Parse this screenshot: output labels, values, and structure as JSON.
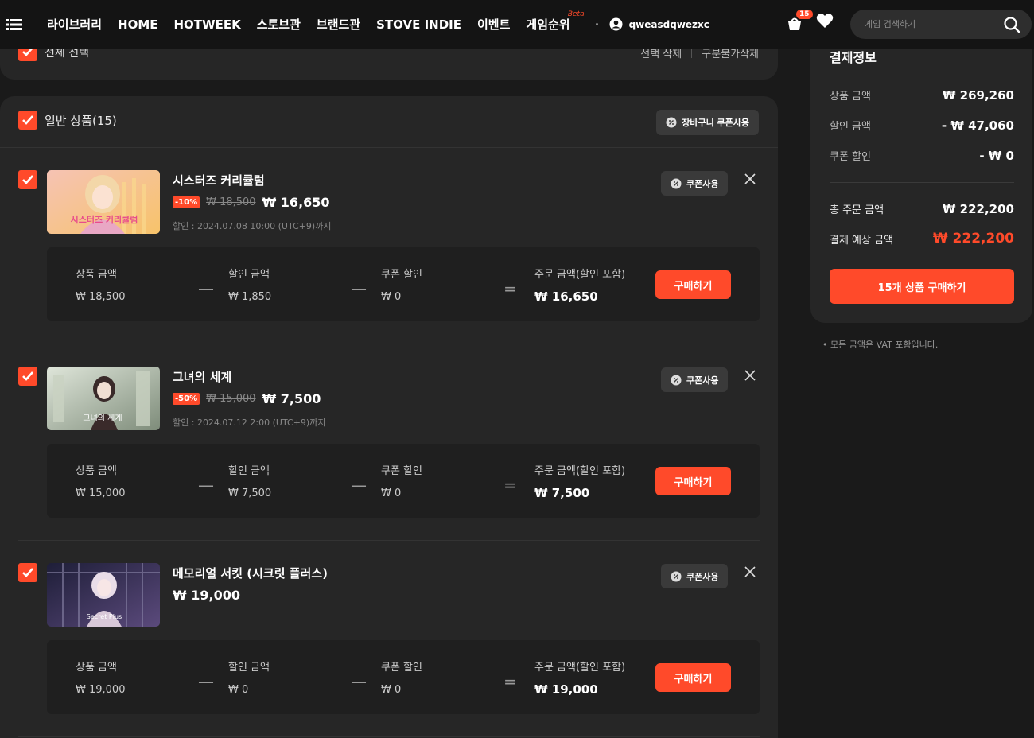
{
  "nav": {
    "links": [
      "라이브러리",
      "HOME",
      "HOTWEEK",
      "스토브관",
      "브랜드관",
      "STOVE INDIE",
      "이벤트",
      "게임순위"
    ],
    "beta": "Beta",
    "username": "qweasdqwezxc",
    "cart_count": "15",
    "search_placeholder": "게임 검색하기"
  },
  "top": {
    "select_all": "전체 선택",
    "delete_selected": "선택 삭제",
    "delete_unavailable": "구분불가삭제"
  },
  "section": {
    "title": "일반 상품(15)",
    "cart_coupon": "장바구니 쿠폰사용"
  },
  "labels": {
    "coupon_use": "쿠폰사용",
    "product_amount": "상품 금액",
    "discount_amount": "할인 금액",
    "coupon_discount": "쿠폰 할인",
    "order_amount": "주문 금액(할인 포함)",
    "buy": "구매하기"
  },
  "items": [
    {
      "name": "시스터즈 커리큘럼",
      "discount": "-10%",
      "original": "₩ 18,500",
      "final": "₩ 16,650",
      "until": "할인 : 2024.07.08 10:00 (UTC+9)까지",
      "product_amount": "₩ 18,500",
      "discount_amount": "₩ 1,850",
      "coupon_discount": "₩ 0",
      "order_amount": "₩ 16,650",
      "thumb_colors": [
        "#f4b6a8",
        "#f9d27a"
      ],
      "thumb_text": "시스터즈 커리큘럼"
    },
    {
      "name": "그녀의 세계",
      "discount": "-50%",
      "original": "₩ 15,000",
      "final": "₩ 7,500",
      "until": "할인 : 2024.07.12 2:00 (UTC+9)까지",
      "product_amount": "₩ 15,000",
      "discount_amount": "₩ 7,500",
      "coupon_discount": "₩ 0",
      "order_amount": "₩ 7,500",
      "thumb_colors": [
        "#cfd7c9",
        "#8c9a86"
      ],
      "thumb_text": "그녀의 세계"
    },
    {
      "name": "메모리얼 서킷 (시크릿 플러스)",
      "discount": "",
      "original": "",
      "final": "₩ 19,000",
      "until": "",
      "product_amount": "₩ 19,000",
      "discount_amount": "₩ 0",
      "coupon_discount": "₩ 0",
      "order_amount": "₩ 19,000",
      "thumb_colors": [
        "#2a2a48",
        "#6a5a8a"
      ],
      "thumb_text": "Secret Plus"
    }
  ],
  "payment": {
    "title": "결제정보",
    "product_amount_label": "상품 금액",
    "product_amount": "₩ 269,260",
    "discount_label": "할인 금액",
    "discount": "- ₩ 47,060",
    "coupon_label": "쿠폰 할인",
    "coupon": "- ₩ 0",
    "total_label": "총 주문 금액",
    "total": "₩ 222,200",
    "expected_label": "결제 예상 금액",
    "expected": "₩ 222,200",
    "buy_all": "15개 상품 구매하기",
    "vat_note": "• 모든 금액은 VAT 포함입니다."
  },
  "colors": {
    "accent": "#ff4a2a",
    "bg": "#1a1a1a",
    "card": "#262626"
  }
}
